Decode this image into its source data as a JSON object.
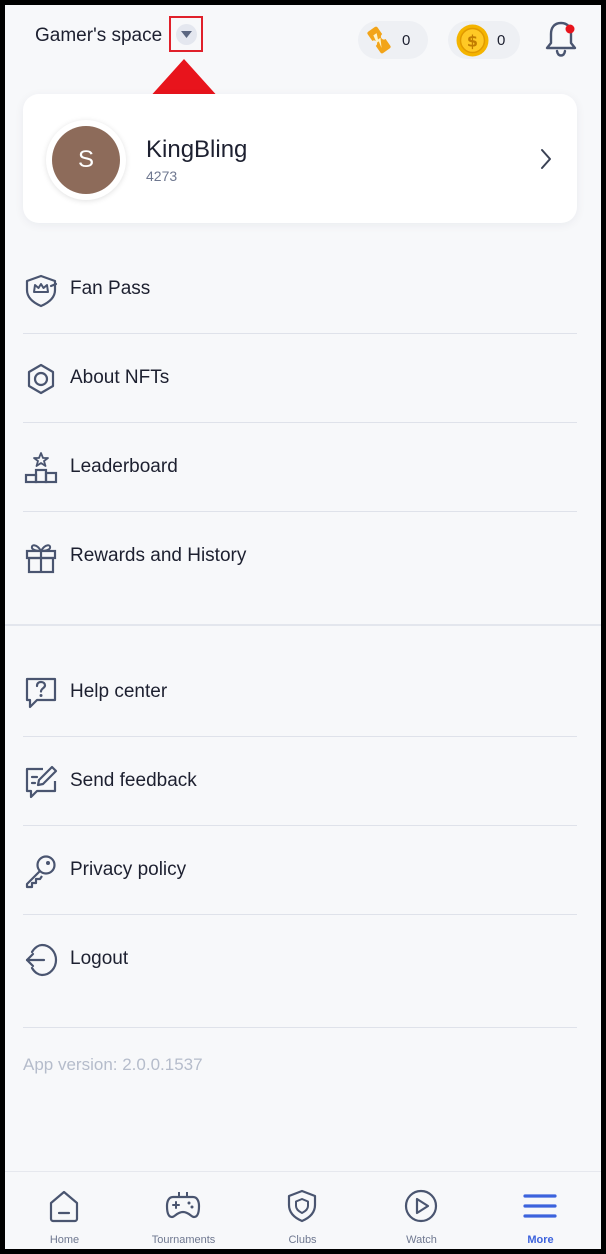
{
  "header": {
    "space_title": "Gamer's space",
    "tickets_count": "0",
    "coins_count": "0"
  },
  "profile": {
    "avatar_initial": "S",
    "name": "KingBling",
    "id": "4273"
  },
  "menu": {
    "section1": [
      {
        "label": "Fan Pass",
        "icon": "fan-pass-icon"
      },
      {
        "label": "About NFTs",
        "icon": "nft-icon"
      },
      {
        "label": "Leaderboard",
        "icon": "leaderboard-icon"
      },
      {
        "label": "Rewards and History",
        "icon": "gift-icon"
      }
    ],
    "section2": [
      {
        "label": "Help center",
        "icon": "help-icon"
      },
      {
        "label": "Send feedback",
        "icon": "feedback-icon"
      },
      {
        "label": "Privacy policy",
        "icon": "key-icon"
      },
      {
        "label": "Logout",
        "icon": "logout-icon"
      }
    ]
  },
  "app_version": "App version: 2.0.0.1537",
  "tabs": [
    {
      "label": "Home",
      "icon": "home-icon"
    },
    {
      "label": "Tournaments",
      "icon": "gamepad-icon"
    },
    {
      "label": "Clubs",
      "icon": "shield-icon"
    },
    {
      "label": "Watch",
      "icon": "play-icon"
    },
    {
      "label": "More",
      "icon": "menu-icon",
      "active": true
    }
  ],
  "colors": {
    "accent": "#3d63dd",
    "highlight_box": "#e0202a",
    "avatar_bg": "#8d6b5a",
    "icon_stroke": "#4a5570"
  }
}
